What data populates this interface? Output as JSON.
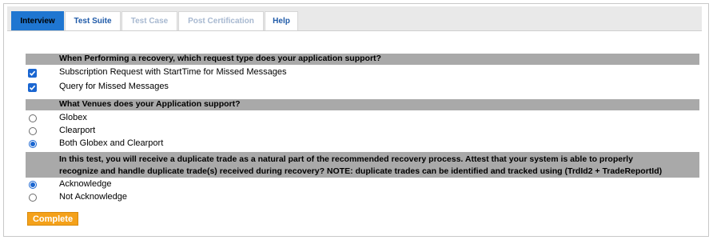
{
  "tabs": [
    {
      "label": "Interview",
      "state": "active"
    },
    {
      "label": "Test Suite",
      "state": "enabled"
    },
    {
      "label": "Test Case",
      "state": "disabled"
    },
    {
      "label": "Post Certification",
      "state": "disabled"
    },
    {
      "label": "Help",
      "state": "enabled"
    }
  ],
  "sections": [
    {
      "question": "When Performing a recovery, which request type does your application support?",
      "options": [
        {
          "label": "Subscription Request with StartTime for Missed Messages",
          "type": "checkbox",
          "checked": true
        },
        {
          "label": "Query for Missed Messages",
          "type": "checkbox",
          "checked": true
        }
      ]
    },
    {
      "question": "What Venues does your Application support?",
      "options": [
        {
          "label": "Globex",
          "type": "radio",
          "checked": false
        },
        {
          "label": "Clearport",
          "type": "radio",
          "checked": false
        },
        {
          "label": "Both Globex and Clearport",
          "type": "radio",
          "checked": true
        }
      ]
    },
    {
      "question_line1": "In this test, you will receive a duplicate trade as a natural part of the recommended recovery process. Attest that your system is able to properly",
      "question_line2": "recognize and handle duplicate trade(s) received during recovery? NOTE: duplicate trades can be identified and tracked using (TrdId2 + TradeReportId)",
      "options": [
        {
          "label": "Acknowledge",
          "type": "radio",
          "checked": true
        },
        {
          "label": "Not Acknowledge",
          "type": "radio",
          "checked": false
        }
      ]
    }
  ],
  "complete_button": {
    "label": "Complete"
  },
  "colors": {
    "accent": "#1f76d1",
    "question_bar": "#a9a9a9",
    "complete": "#f4a11a"
  }
}
